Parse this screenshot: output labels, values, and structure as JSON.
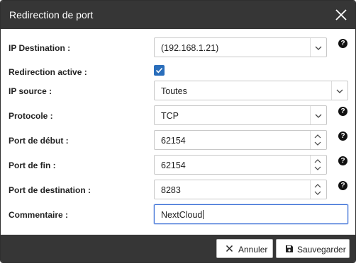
{
  "dialog": {
    "title": "Redirection de port",
    "close_icon": "close-icon"
  },
  "form": {
    "ip_destination": {
      "label": "IP Destination :",
      "value": "(192.168.1.21)"
    },
    "redirection_active": {
      "label": "Redirection active :",
      "checked": true
    },
    "ip_source": {
      "label": "IP source :",
      "value": "Toutes"
    },
    "protocole": {
      "label": "Protocole :",
      "value": "TCP"
    },
    "port_debut": {
      "label": "Port de début :",
      "value": "62154"
    },
    "port_fin": {
      "label": "Port de fin :",
      "value": "62154"
    },
    "port_destination": {
      "label": "Port de destination :",
      "value": "8283"
    },
    "commentaire": {
      "label": "Commentaire :",
      "value": "NextCloud"
    },
    "help_glyph": "?"
  },
  "footer": {
    "cancel_label": "Annuler",
    "save_label": "Sauvegarder"
  },
  "colors": {
    "titlebar": "#363636",
    "footer": "#363636",
    "checkbox": "#2a6ebb",
    "focus": "#3b6fd6"
  }
}
